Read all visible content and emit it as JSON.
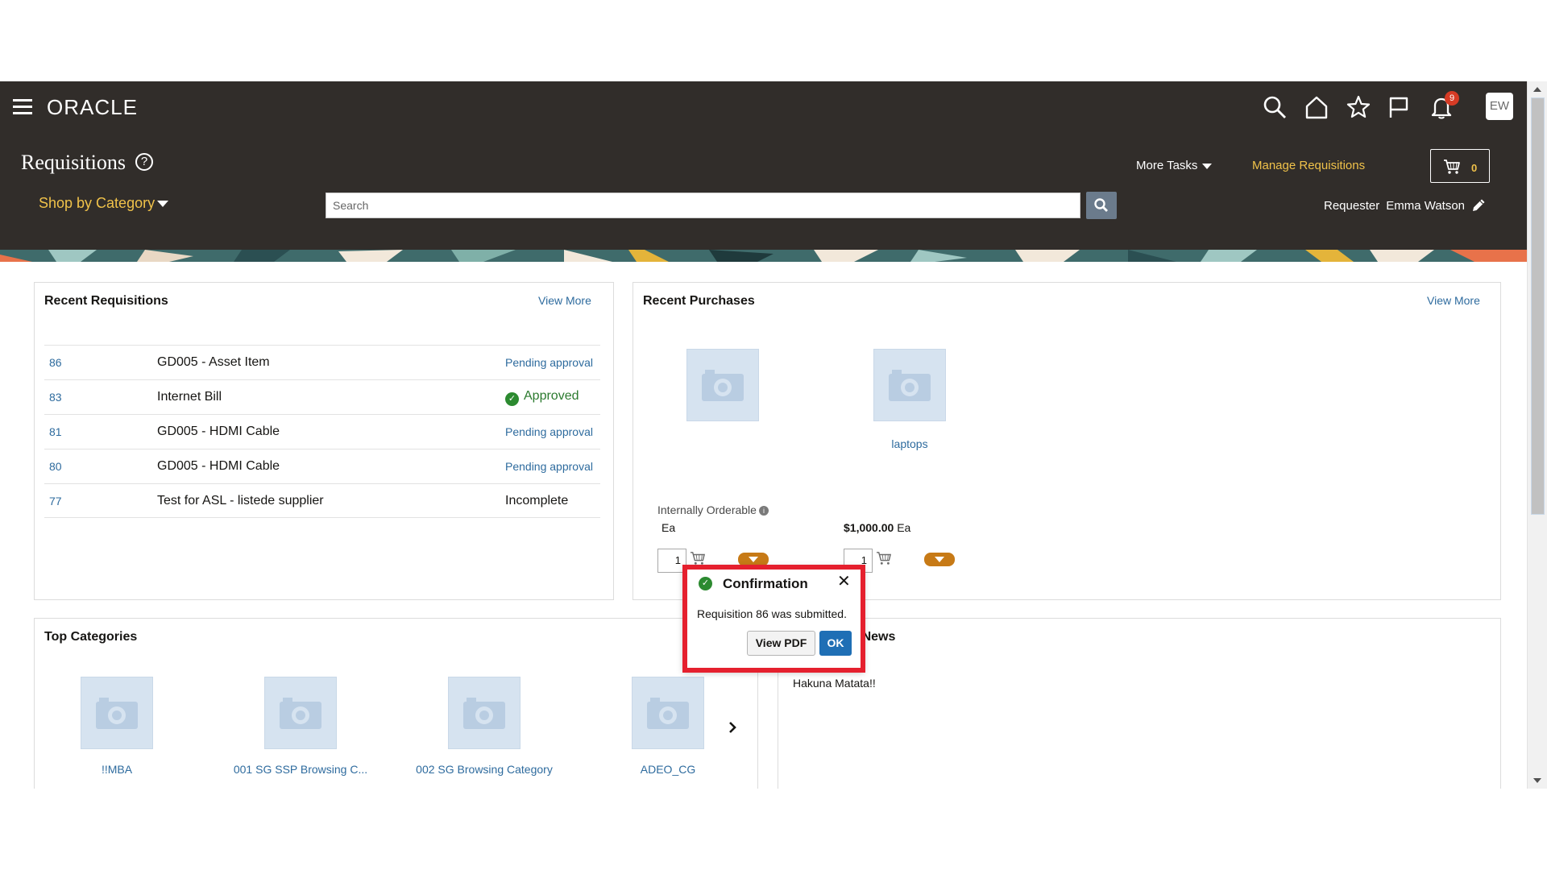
{
  "header": {
    "logo": "ORACLE",
    "page_title": "Requisitions",
    "help_glyph": "?",
    "shop_by_category": "Shop by Category",
    "search_placeholder": "Search",
    "more_tasks": "More Tasks",
    "manage_requisitions": "Manage Requisitions",
    "cart_count": "0",
    "notification_count": "9",
    "avatar_initials": "EW",
    "requester_label": "Requester",
    "requester_name": "Emma Watson"
  },
  "recent_requisitions": {
    "title": "Recent Requisitions",
    "view_more": "View More",
    "rows": [
      {
        "number": "86",
        "description": "GD005 - Asset Item",
        "status": "Pending approval"
      },
      {
        "number": "83",
        "description": "Internet Bill",
        "status": "Approved"
      },
      {
        "number": "81",
        "description": "GD005 - HDMI Cable",
        "status": "Pending approval"
      },
      {
        "number": "80",
        "description": "GD005 - HDMI Cable",
        "status": "Pending approval"
      },
      {
        "number": "77",
        "description": "Test for ASL - listede supplier",
        "status": "Incomplete"
      }
    ]
  },
  "recent_purchases": {
    "title": "Recent Purchases",
    "view_more": "View More",
    "items": [
      {
        "name": "",
        "availability": "Internally Orderable",
        "price": "",
        "uom": "Ea",
        "quantity": "1"
      },
      {
        "name": "laptops",
        "availability": "",
        "price": "$1,000.00",
        "uom": "Ea",
        "quantity": "1"
      }
    ]
  },
  "top_categories": {
    "title": "Top Categories",
    "items": [
      {
        "name": "!!MBA"
      },
      {
        "name": "001 SG SSP Browsing C..."
      },
      {
        "name": "002 SG Browsing Category"
      },
      {
        "name": "ADEO_CG"
      }
    ]
  },
  "purchasing_news": {
    "title": "Purchasing News",
    "text": "Hakuna Matata!!"
  },
  "confirmation_dialog": {
    "title": "Confirmation",
    "message": "Requisition 86 was submitted.",
    "view_pdf": "View PDF",
    "ok": "OK",
    "highlight_color": "#e5202e"
  },
  "colors": {
    "header_bg": "#312d2a",
    "link": "#2e6b9e",
    "accent_gold": "#f0c24a",
    "ok_button": "#1f6fb5",
    "menu_button": "#c77a16"
  }
}
